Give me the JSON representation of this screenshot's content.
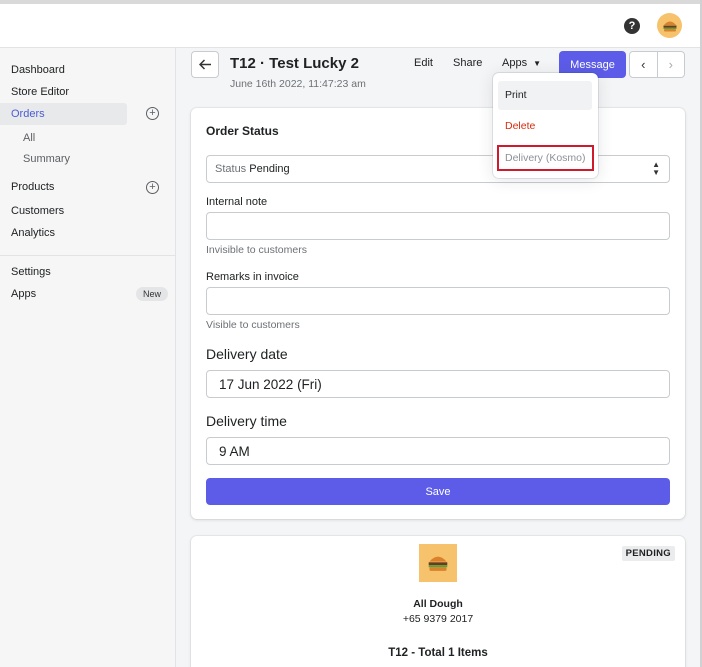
{
  "sidebar": {
    "dashboard": "Dashboard",
    "store_editor": "Store Editor",
    "orders": "Orders",
    "orders_all": "All",
    "orders_summary": "Summary",
    "products": "Products",
    "customers": "Customers",
    "analytics": "Analytics",
    "settings": "Settings",
    "apps": "Apps",
    "apps_badge": "New"
  },
  "header": {
    "help_icon": "?",
    "title": "T12 · Test Lucky 2",
    "date": "June 16th 2022, 11:47:23 am",
    "edit": "Edit",
    "share": "Share",
    "apps": "Apps",
    "message": "Message"
  },
  "apps_menu": {
    "print": "Print",
    "delete": "Delete",
    "delivery": "Delivery (Kosmo)"
  },
  "order_status": {
    "title": "Order Status",
    "status_prefix": "Status",
    "status_value": "Pending",
    "internal_note_label": "Internal note",
    "internal_note_value": "",
    "internal_note_help": "Invisible to customers",
    "remarks_label": "Remarks in invoice",
    "remarks_value": "",
    "remarks_help": "Visible to customers",
    "delivery_date_label": "Delivery date",
    "delivery_date_value": "17 Jun 2022 (Fri)",
    "delivery_time_label": "Delivery time",
    "delivery_time_value": "9 AM",
    "save": "Save"
  },
  "invoice": {
    "status": "PENDING",
    "store_name": "All Dough",
    "phone": "+65 9379 2017",
    "summary": "T12 - Total 1 Items"
  },
  "colors": {
    "accent": "#5c5ce8",
    "active_nav": "#4b5bd6",
    "danger": "#d72c0d",
    "highlight_border": "#d0192b",
    "logo_bg": "#f6c26b"
  }
}
